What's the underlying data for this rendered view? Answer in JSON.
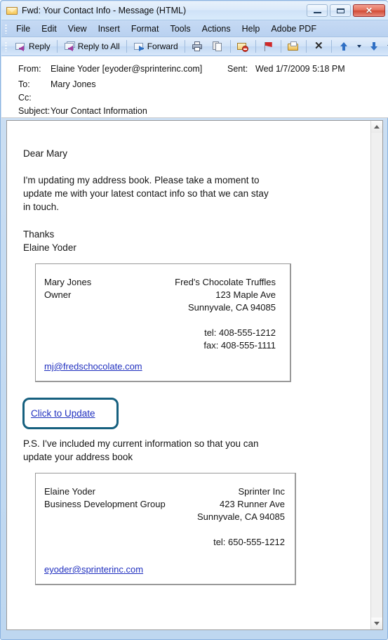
{
  "window": {
    "title": "Fwd: Your Contact Info - Message (HTML)",
    "app_icon": "envelope-icon",
    "buttons": {
      "minimize": "minimize-button",
      "restore": "restore-button",
      "close_glyph": "✕"
    }
  },
  "menubar": {
    "items": [
      {
        "label": "File",
        "accel": "F"
      },
      {
        "label": "Edit",
        "accel": "E"
      },
      {
        "label": "View",
        "accel": "V"
      },
      {
        "label": "Insert",
        "accel": "I"
      },
      {
        "label": "Format",
        "accel": "o"
      },
      {
        "label": "Tools",
        "accel": "T"
      },
      {
        "label": "Actions",
        "accel": "A"
      },
      {
        "label": "Help",
        "accel": "H"
      },
      {
        "label": "Adobe PDF",
        "accel": "P"
      }
    ]
  },
  "toolbar": {
    "reply_label": "Reply",
    "reply_all_label": "Reply to All",
    "forward_label": "Forward",
    "icons": [
      "print-icon",
      "copy-icon",
      "junk-mail-icon",
      "follow-up-flag-icon",
      "move-to-folder-icon",
      "delete-icon",
      "previous-item-icon",
      "next-item-icon",
      "help-icon"
    ],
    "overflow_label": "toolbar-options"
  },
  "header": {
    "from_label": "From:",
    "from_value": "Elaine Yoder [eyoder@sprinterinc.com]",
    "sent_label": "Sent:",
    "sent_value": "Wed 1/7/2009 5:18 PM",
    "to_label": "To:",
    "to_value": "Mary Jones",
    "cc_label": "Cc:",
    "cc_value": "",
    "subject_label": "Subject:",
    "subject_value": "Your Contact Information"
  },
  "body": {
    "greeting": "Dear Mary",
    "paragraph_line1": "I'm updating my address book. Please take a moment to",
    "paragraph_line2": "update me with your latest contact info so that we can stay",
    "paragraph_line3": "in touch.",
    "closing": "Thanks",
    "signature": "Elaine Yoder",
    "ps_line1": "P.S. I've included my current information so that you can",
    "ps_line2": "update your address book"
  },
  "cta": {
    "label": "Click to Update",
    "highlight_color": "#16607f",
    "link_color": "#1f2fbf"
  },
  "vcard_recipient": {
    "name": "Mary Jones",
    "title": "Owner",
    "company": "Fred's Chocolate Truffles",
    "street": "123 Maple Ave",
    "city_state_zip": "Sunnyvale, CA 94085",
    "tel": "tel: 408-555-1212",
    "fax": "fax: 408-555-1111",
    "email": "mj@fredschocolate.com"
  },
  "vcard_sender": {
    "name": "Elaine Yoder",
    "title": "Business Development Group",
    "company": "Sprinter Inc",
    "street": "423 Runner Ave",
    "city_state_zip": "Sunnyvale, CA 94085",
    "tel": "tel: 650-555-1212",
    "email": "eyoder@sprinterinc.com"
  },
  "scrollbar": {
    "up_icon": "scroll-up-icon",
    "down_icon": "scroll-down-icon"
  }
}
